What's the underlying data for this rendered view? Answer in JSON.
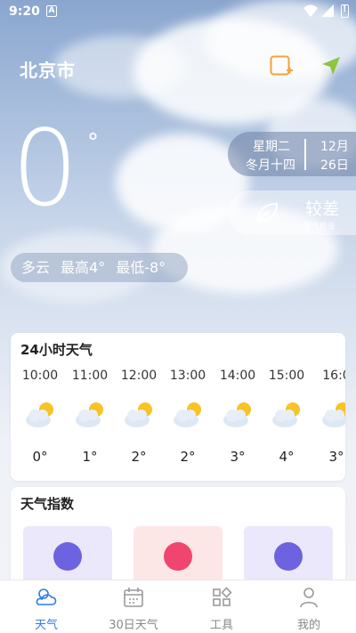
{
  "status_bar": {
    "time": "9:20",
    "notification_icon": "A"
  },
  "header": {
    "city": "北京市",
    "add_icon": "add-city-icon",
    "location_icon": "location-arrow-icon"
  },
  "current": {
    "temperature": "0",
    "degree_symbol": "°",
    "weekday": "星期二",
    "lunar_date": "冬月十四",
    "month": "12月",
    "day": "26日",
    "air_quality": "较差",
    "air_quality_label": "空气质量",
    "condition": "多云",
    "high": "最高4°",
    "low": "最低-8°"
  },
  "hourly": {
    "title": "24小时天气",
    "items": [
      {
        "time": "10:00",
        "temp": "0°",
        "icon": "partly-cloudy-icon"
      },
      {
        "time": "11:00",
        "temp": "1°",
        "icon": "partly-cloudy-icon"
      },
      {
        "time": "12:00",
        "temp": "2°",
        "icon": "partly-cloudy-icon"
      },
      {
        "time": "13:00",
        "temp": "2°",
        "icon": "partly-cloudy-icon"
      },
      {
        "time": "14:00",
        "temp": "3°",
        "icon": "partly-cloudy-icon"
      },
      {
        "time": "15:00",
        "temp": "4°",
        "icon": "partly-cloudy-icon"
      },
      {
        "time": "16:0",
        "temp": "3°",
        "icon": "partly-cloudy-icon"
      }
    ]
  },
  "indices": {
    "title": "天气指数",
    "items": [
      {
        "icon": "basketball-icon",
        "bg": "#ece8fb",
        "circle": "#6d63e0"
      },
      {
        "icon": "clothing-icon",
        "bg": "#fde6e6",
        "circle": "#f0456f"
      },
      {
        "icon": "umbrella-icon",
        "bg": "#ece8fb",
        "circle": "#6d63e0"
      }
    ]
  },
  "nav": {
    "items": [
      {
        "label": "天气",
        "icon": "weather-icon",
        "active": true
      },
      {
        "label": "30日天气",
        "icon": "calendar-icon",
        "active": false
      },
      {
        "label": "工具",
        "icon": "tools-grid-icon",
        "active": false
      },
      {
        "label": "我的",
        "icon": "profile-icon",
        "active": false
      }
    ]
  },
  "colors": {
    "accent": "#2f7be8",
    "add_icon": "#f2a33a",
    "location_icon": "#8dc63f"
  }
}
